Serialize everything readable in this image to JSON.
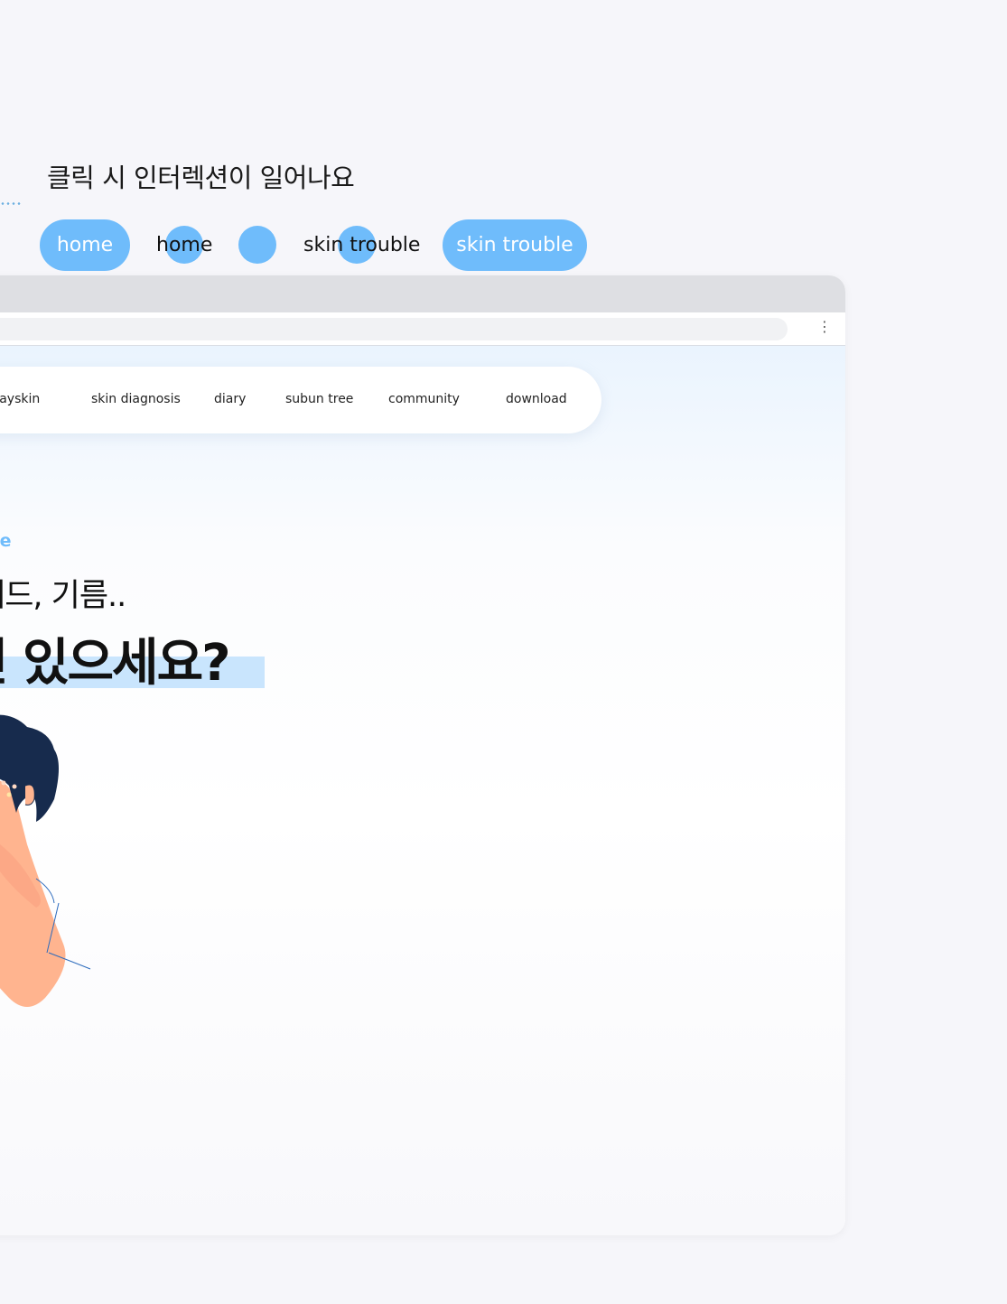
{
  "caption": "클릭 시 인터렉션이 일어나요",
  "demo": {
    "home_active": "home",
    "home_hover": "home",
    "skin_hover": "skin trouble",
    "skin_active": "skin trouble"
  },
  "browser": {
    "menu_icon": "kebab-menu-icon"
  },
  "nav": {
    "items": [
      "n dayskin",
      "skin diagnosis",
      "diary",
      "subun tree",
      "community",
      "download"
    ]
  },
  "hero": {
    "subtitle": "uble",
    "line2": "헤드, 기름..",
    "line1": "민 있으세요?"
  },
  "colors": {
    "accent": "#6fbcfb",
    "highlight": "#c9e5fd",
    "background": "#f6f6fa"
  }
}
